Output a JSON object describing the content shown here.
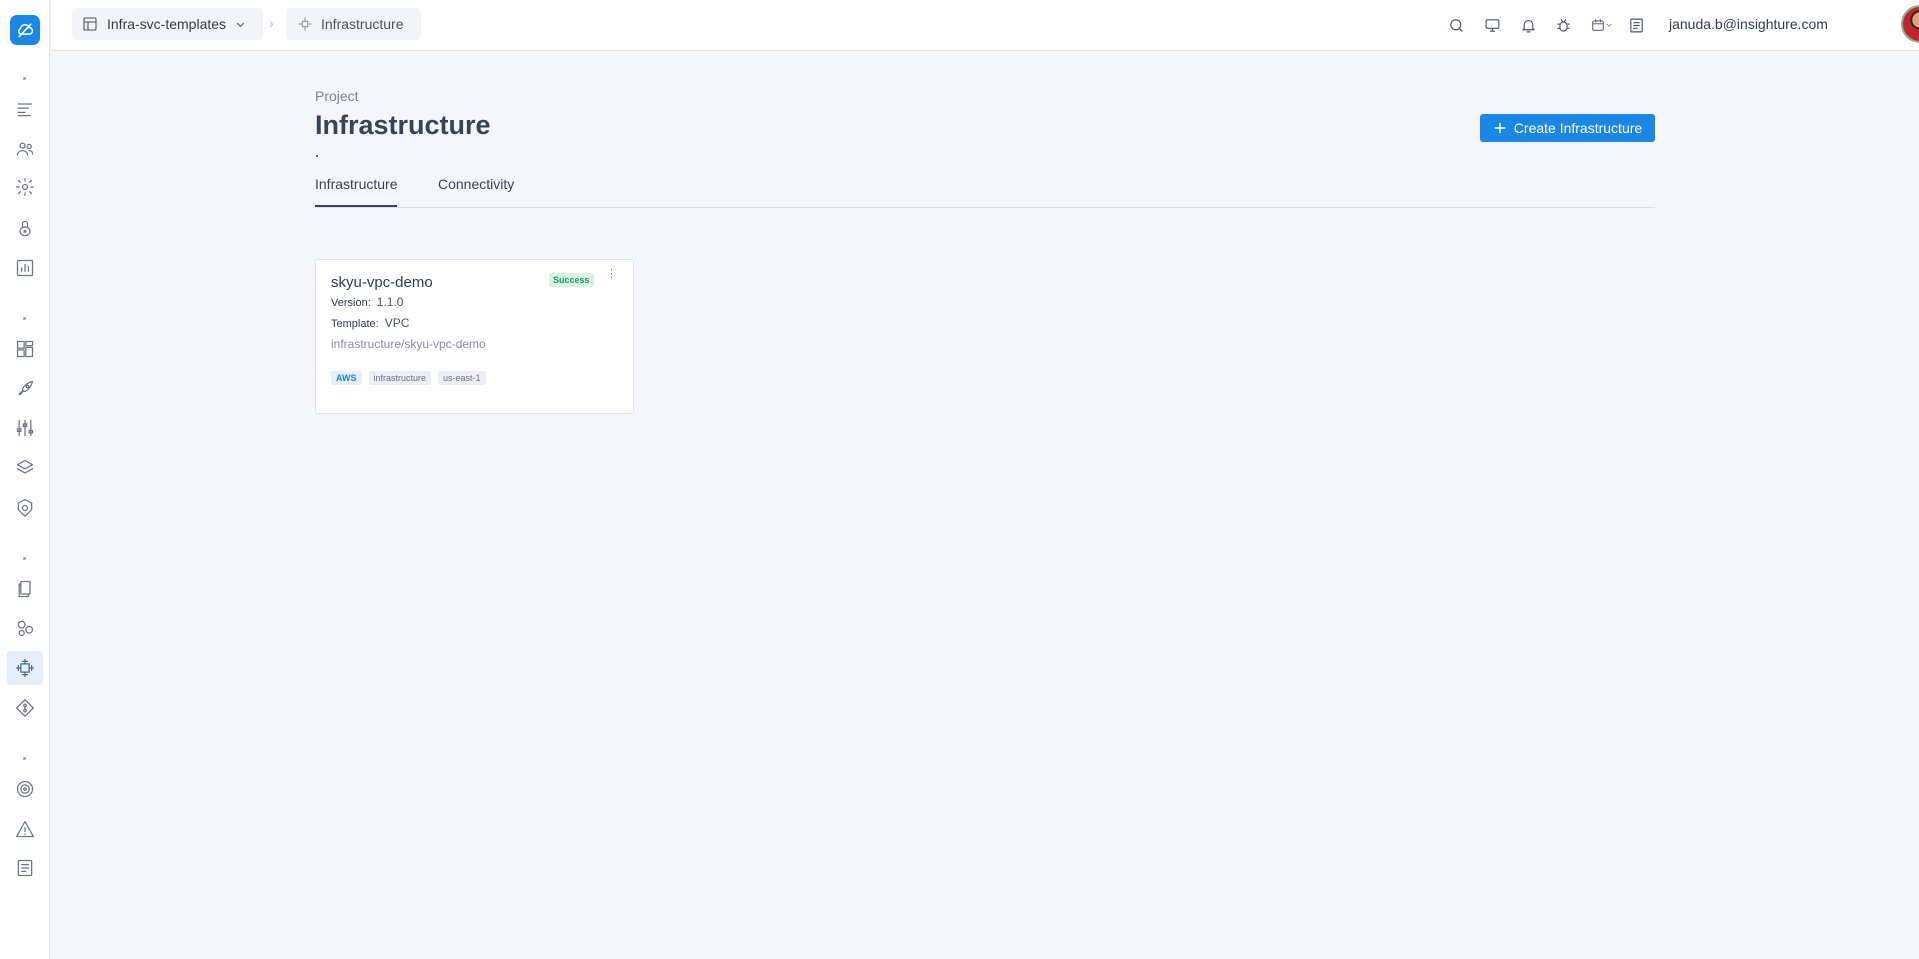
{
  "colors": {
    "accent": "#1a86e6",
    "success_text": "#1f9a6b",
    "success_bg": "#d8f3e6"
  },
  "sidebar": {
    "logo_icon": "cloud-logo-icon",
    "items": [
      {
        "name": "list-icon"
      },
      {
        "name": "users-icon"
      },
      {
        "name": "settings-icon"
      },
      {
        "name": "lock-icon"
      },
      {
        "name": "bar-chart-icon"
      },
      {
        "name": "dashboard-icon"
      },
      {
        "name": "rocket-icon"
      },
      {
        "name": "sliders-icon"
      },
      {
        "name": "layers-icon"
      },
      {
        "name": "helm-icon"
      },
      {
        "name": "documents-icon"
      },
      {
        "name": "circles-icon"
      },
      {
        "name": "infrastructure-icon",
        "active": true
      },
      {
        "name": "git-icon"
      },
      {
        "name": "target-icon"
      },
      {
        "name": "alert-icon"
      },
      {
        "name": "logs-icon"
      }
    ]
  },
  "topbar": {
    "project_name": "Infra-svc-templates",
    "current_page": "Infrastructure",
    "icons": [
      "search-icon",
      "monitor-icon",
      "bell-icon",
      "bug-icon",
      "calendar-icon",
      "notes-icon"
    ],
    "user_email": "januda.b@insighture.com"
  },
  "main": {
    "project_label": "Project",
    "title": "Infrastructure",
    "create_button": "Create Infrastructure",
    "tabs": [
      {
        "label": "Infrastructure",
        "active": true
      },
      {
        "label": "Connectivity",
        "active": false
      }
    ]
  },
  "cards": [
    {
      "name": "skyu-vpc-demo",
      "status": "Success",
      "version_label": "Version:",
      "version": "1.1.0",
      "template_label": "Template:",
      "template": "VPC",
      "path": "infrastructure/skyu-vpc-demo",
      "tags": [
        "AWS",
        "infrastructure",
        "us-east-1"
      ]
    }
  ]
}
